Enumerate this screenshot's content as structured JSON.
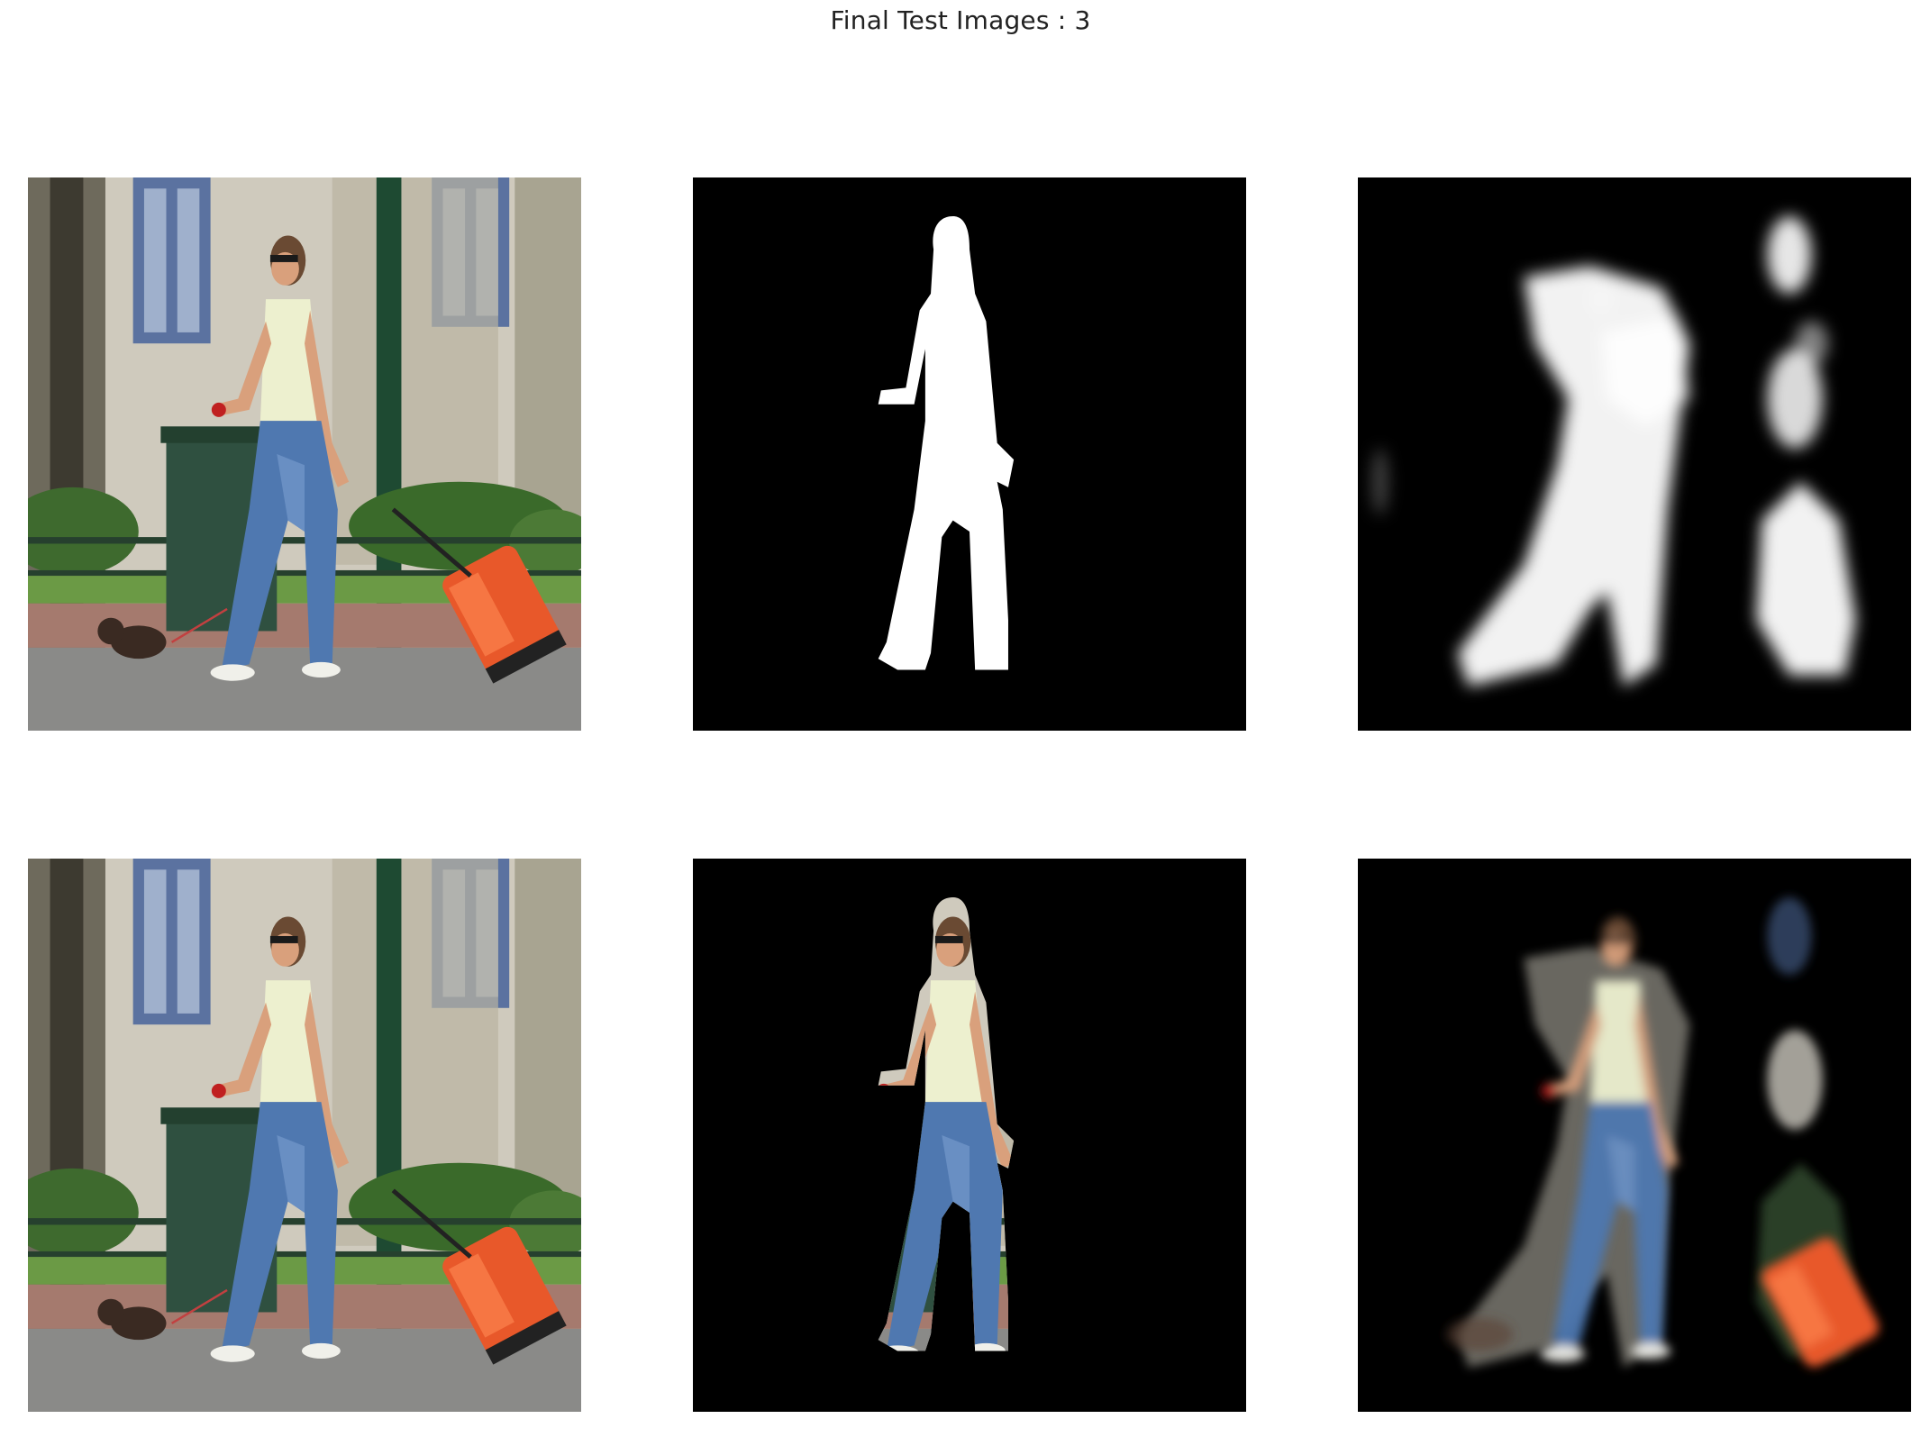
{
  "figure": {
    "title": "Final Test Images : 3"
  },
  "panels": {
    "row1": [
      "input-photo",
      "ground-truth-mask",
      "predicted-mask"
    ],
    "row2": [
      "input-photo",
      "ground-truth-masked-photo",
      "predicted-masked-photo"
    ]
  },
  "colors": {
    "background": "#ffffff",
    "mask_background": "#000000",
    "mask_foreground": "#ffffff",
    "jeans": "#4f78b0",
    "suitcase": "#e8582a",
    "bin": "#2f5040",
    "building": "#cfcabd",
    "pole": "#1e4a32",
    "road": "#8a8a88"
  }
}
